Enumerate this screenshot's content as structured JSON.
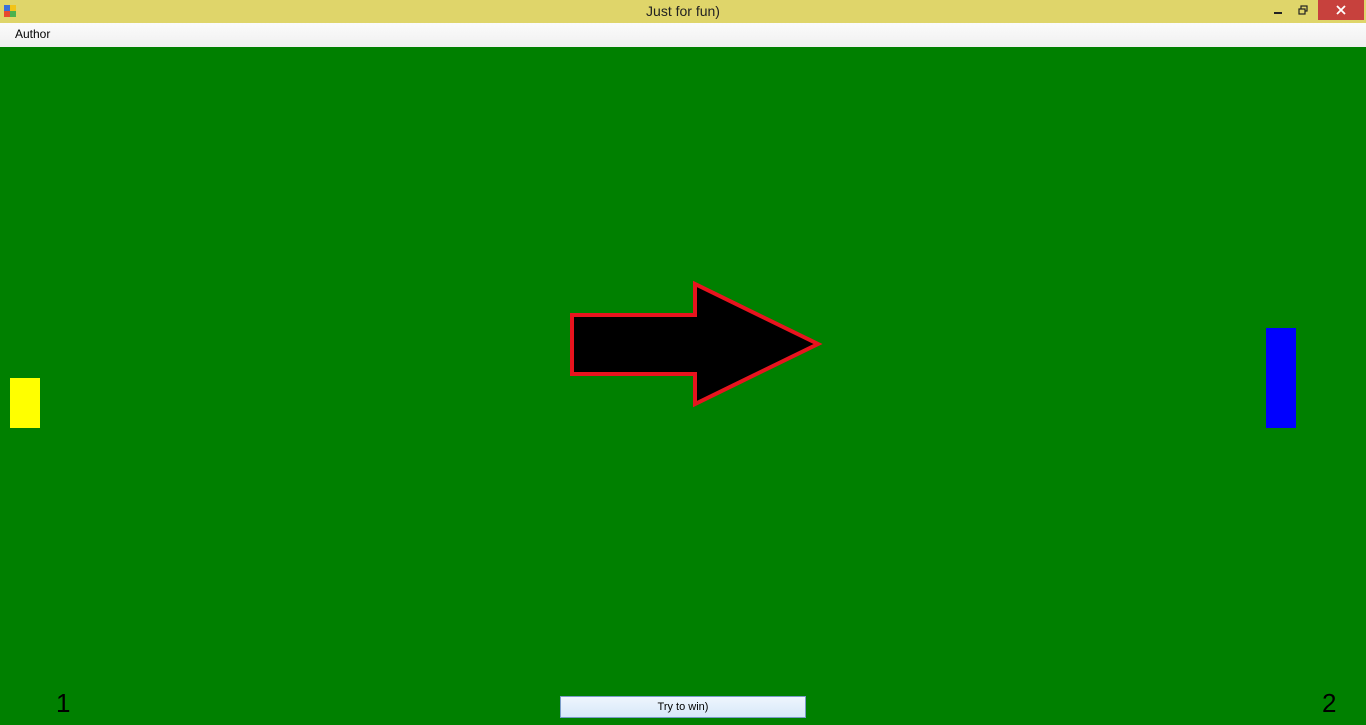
{
  "window": {
    "title": "Just for fun)",
    "minimize_icon": "minimize-icon",
    "maximize_icon": "restore-icon",
    "close_icon": "close-icon",
    "title_color": "#dfd56a",
    "close_color": "#c7413d"
  },
  "menu": {
    "items": [
      {
        "label": "Author"
      }
    ]
  },
  "game": {
    "field_color": "#008000",
    "left_paddle_color": "#ffff00",
    "right_paddle_color": "#0000ff",
    "arrow_fill": "#000000",
    "arrow_stroke": "#e8141e",
    "arrow_direction": "right",
    "score_left": "1",
    "score_right": "2",
    "button_label": "Try to win)"
  }
}
